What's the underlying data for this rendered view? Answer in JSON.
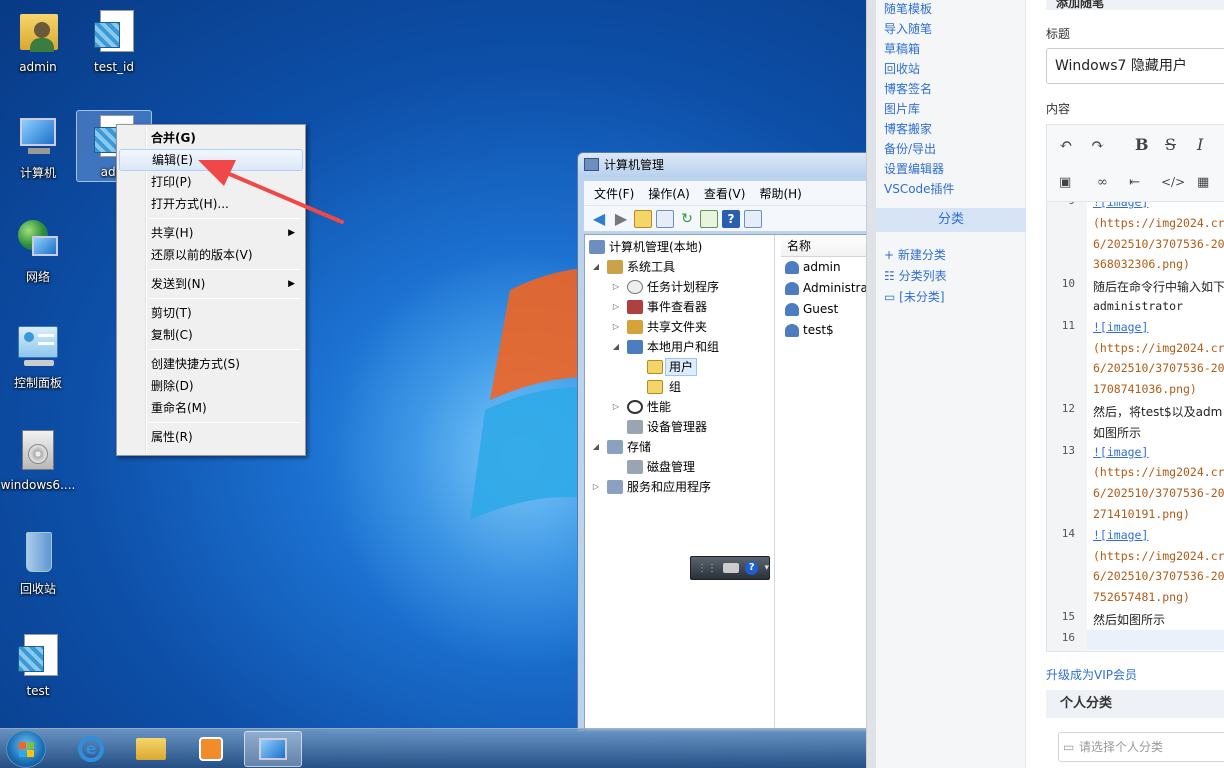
{
  "desktop": {
    "icons": [
      {
        "label": "admin",
        "icon": "user-folder-icon"
      },
      {
        "label": "test_id",
        "icon": "registry-file-icon"
      },
      {
        "label": "计算机",
        "icon": "computer-icon"
      },
      {
        "label": "adm",
        "icon": "registry-file-icon"
      },
      {
        "label": "网络",
        "icon": "network-icon"
      },
      {
        "label": "控制面板",
        "icon": "control-panel-icon"
      },
      {
        "label": "windows6....",
        "icon": "installer-icon"
      },
      {
        "label": "回收站",
        "icon": "recycle-bin-icon"
      },
      {
        "label": "test",
        "icon": "registry-file-icon"
      }
    ],
    "context_menu": {
      "items": [
        "合并(G)",
        "编辑(E)",
        "打印(P)",
        "打开方式(H)...",
        "共享(H)",
        "还原以前的版本(V)",
        "发送到(N)",
        "剪切(T)",
        "复制(C)",
        "创建快捷方式(S)",
        "删除(D)",
        "重命名(M)",
        "属性(R)"
      ],
      "highlighted": "编辑(E)"
    }
  },
  "computer_management": {
    "title": "计算机管理",
    "menu": [
      "文件(F)",
      "操作(A)",
      "查看(V)",
      "帮助(H)"
    ],
    "tree": [
      "计算机管理(本地)",
      "系统工具",
      "任务计划程序",
      "事件查看器",
      "共享文件夹",
      "本地用户和组",
      "用户",
      "组",
      "性能",
      "设备管理器",
      "存储",
      "磁盘管理",
      "服务和应用程序"
    ],
    "list_header": "名称",
    "users": [
      "admin",
      "Administrat",
      "Guest",
      "test$"
    ]
  },
  "taskbar": {
    "apps": [
      "internet-explorer-icon",
      "explorer-folder-icon",
      "media-player-icon",
      "computer-management-icon"
    ],
    "active": "computer-management-icon"
  },
  "blog": {
    "side_links": [
      "随笔模板",
      "导入随笔",
      "草稿箱",
      "回收站",
      "博客签名",
      "图片库",
      "博客搬家",
      "备份/导出",
      "设置编辑器",
      "VSCode插件"
    ],
    "category_header": "分类",
    "category_links": [
      "+ 新建分类",
      "分类列表",
      "[未分类]"
    ],
    "editor_header": "添加随笔",
    "title_label": "标题",
    "title_value": "Windows7 隐藏用户",
    "content_label": "内容",
    "toolbar": [
      "undo-icon",
      "redo-icon",
      "bold-icon",
      "strikethrough-icon",
      "italic-icon",
      "image-icon",
      "link-icon",
      "indent-icon",
      "code-icon",
      "table-icon"
    ],
    "code_lines": [
      {
        "n": "9",
        "t": "![image]"
      },
      {
        "n": "",
        "t": "(https://img2024.cr"
      },
      {
        "n": "",
        "t": "6/202510/3707536-20"
      },
      {
        "n": "",
        "t": "368032306.png)"
      },
      {
        "n": "10",
        "t": "随后在命令行中输入如下"
      },
      {
        "n": "",
        "t": "administrator"
      },
      {
        "n": "11",
        "t": "![image]"
      },
      {
        "n": "",
        "t": "(https://img2024.cr"
      },
      {
        "n": "",
        "t": "6/202510/3707536-20"
      },
      {
        "n": "",
        "t": "1708741036.png)"
      },
      {
        "n": "12",
        "t": "然后，将test$以及adm"
      },
      {
        "n": "",
        "t": "如图所示"
      },
      {
        "n": "13",
        "t": "![image]"
      },
      {
        "n": "",
        "t": "(https://img2024.cr"
      },
      {
        "n": "",
        "t": "6/202510/3707536-20"
      },
      {
        "n": "",
        "t": "271410191.png)"
      },
      {
        "n": "14",
        "t": "![image]"
      },
      {
        "n": "",
        "t": "(https://img2024.cr"
      },
      {
        "n": "",
        "t": "6/202510/3707536-20"
      },
      {
        "n": "",
        "t": "752657481.png)"
      },
      {
        "n": "15",
        "t": "然后如图所示"
      },
      {
        "n": "16",
        "t": ""
      }
    ],
    "vip_link": "升级成为VIP会员",
    "personal_category": "个人分类",
    "category_placeholder": "请选择个人分类"
  },
  "colors": {
    "link": "#2f6fd1",
    "arrow": "#f04848",
    "desktop": "#1b6fcf"
  }
}
